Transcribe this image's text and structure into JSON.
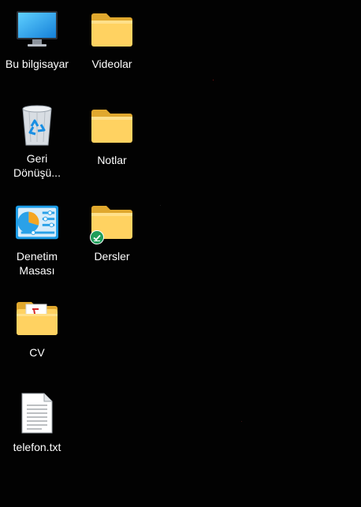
{
  "desktop": {
    "background_color": "#020202",
    "icons": [
      {
        "label": "Bu bilgisayar",
        "icon": "monitor-icon"
      },
      {
        "label": "Videolar",
        "icon": "folder-icon"
      },
      {
        "label": "Geri\nDönüşü...",
        "icon": "recycle-bin-icon"
      },
      {
        "label": "Notlar",
        "icon": "folder-icon"
      },
      {
        "label": "Denetim\nMasası",
        "icon": "control-panel-icon"
      },
      {
        "label": "Dersler",
        "icon": "folder-synced-icon",
        "badge": "sync-check-badge-icon"
      },
      {
        "label": "CV",
        "icon": "pdf-folder-icon"
      },
      {
        "label": "telefon.txt",
        "icon": "text-file-icon"
      }
    ]
  },
  "colors": {
    "folder": "#F5C34A",
    "folder_light": "#FFD768",
    "monitor_blue": "#1FA2E8",
    "badge_green": "#1E9E5A"
  }
}
